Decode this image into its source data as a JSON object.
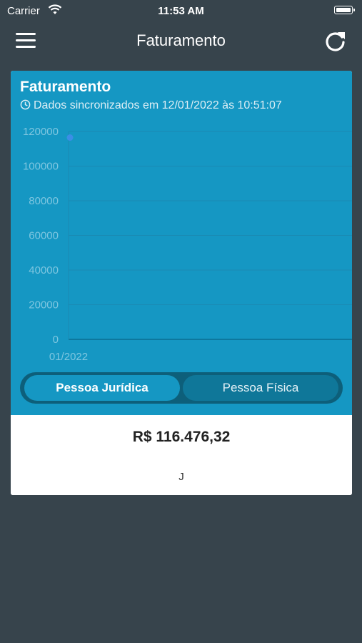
{
  "status_bar": {
    "carrier": "Carrier",
    "time": "11:53 AM"
  },
  "nav": {
    "title": "Faturamento",
    "menu_icon": "hamburger-menu-icon",
    "refresh_icon": "refresh-icon"
  },
  "card": {
    "title": "Faturamento",
    "sync_text": "Dados sincronizados em 12/01/2022 às 10:51:07",
    "background_color": "#1597c3",
    "segments": {
      "left": "Pessoa Jurídica",
      "right": "Pessoa Física",
      "selected": "Pessoa Jurídica"
    },
    "total": "R$ 116.476,32",
    "legend_label": "J"
  },
  "chart_data": {
    "type": "line",
    "x": [
      "01/2022"
    ],
    "series": [
      {
        "values": [
          116476.32
        ],
        "color": "#3b8ee6"
      }
    ],
    "yticks": [
      0,
      20000,
      40000,
      60000,
      80000,
      100000,
      120000
    ],
    "ylim": [
      0,
      120000
    ],
    "grid": true
  }
}
